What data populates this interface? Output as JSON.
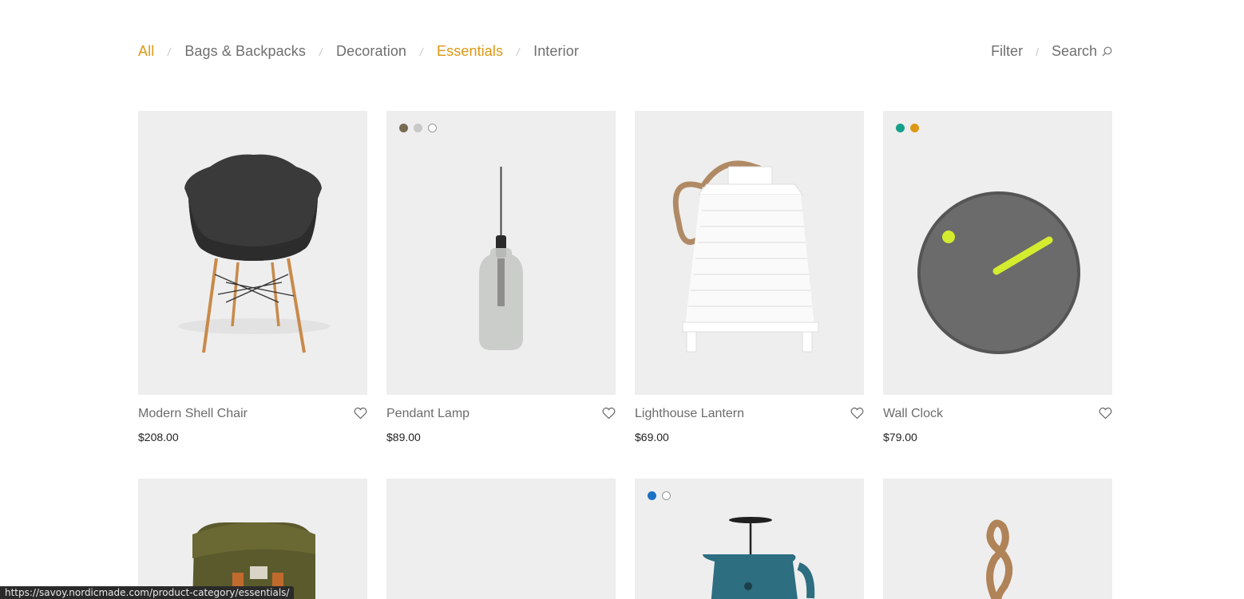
{
  "categories": [
    {
      "label": "All",
      "active": true
    },
    {
      "label": "Bags & Backpacks",
      "active": false
    },
    {
      "label": "Decoration",
      "active": false
    },
    {
      "label": "Essentials",
      "active": true
    },
    {
      "label": "Interior",
      "active": false
    }
  ],
  "separator": "/",
  "right_nav": {
    "filter_label": "Filter",
    "search_label": "Search",
    "search_icon": "search-icon"
  },
  "products": [
    {
      "name": "Modern Shell Chair",
      "price": "$208.00",
      "swatches": []
    },
    {
      "name": "Pendant Lamp",
      "price": "$89.00",
      "swatches": [
        "#7a6a52",
        "#c8c8c8",
        "#ffffff"
      ]
    },
    {
      "name": "Lighthouse Lantern",
      "price": "$69.00",
      "swatches": []
    },
    {
      "name": "Wall Clock",
      "price": "$79.00",
      "swatches": [
        "#16a08c",
        "#dc9814"
      ]
    }
  ],
  "products_row2": [
    {
      "image": "backpack",
      "swatches": []
    },
    {
      "image": "empty",
      "swatches": []
    },
    {
      "image": "coffee-press",
      "swatches": [
        "#1a72c4",
        "#ffffff"
      ]
    },
    {
      "image": "rope",
      "swatches": []
    }
  ],
  "heart_icon": "heart-icon",
  "colors": {
    "accent": "#dc9814",
    "card_bg": "#eeeeee"
  },
  "status_url": "https://savoy.nordicmade.com/product-category/essentials/"
}
